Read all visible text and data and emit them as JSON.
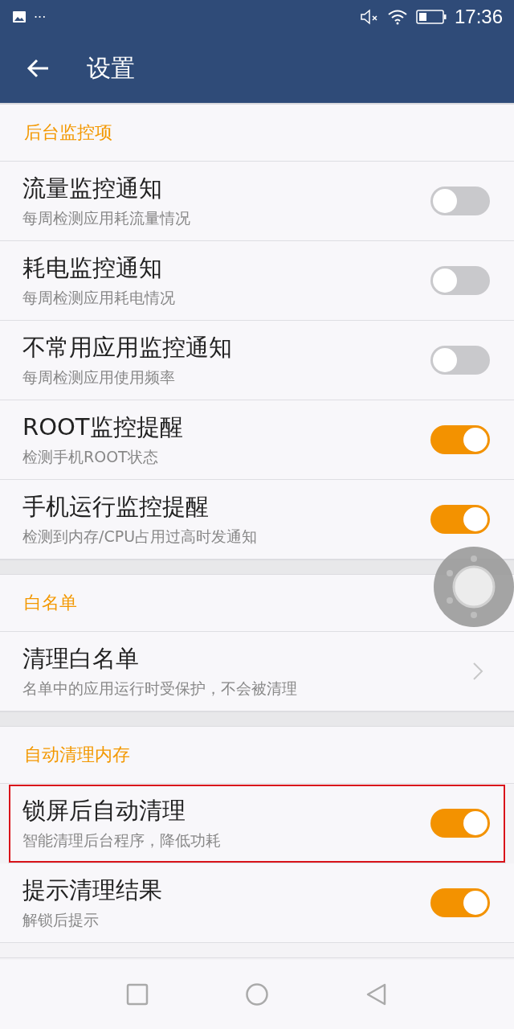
{
  "status_bar": {
    "notification_more": "···",
    "time": "17:36"
  },
  "toolbar": {
    "title": "设置"
  },
  "sections": [
    {
      "header": "后台监控项",
      "items": [
        {
          "kind": "toggle",
          "title": "流量监控通知",
          "subtitle": "每周检测应用耗流量情况",
          "on": false,
          "highlighted": false
        },
        {
          "kind": "toggle",
          "title": "耗电监控通知",
          "subtitle": "每周检测应用耗电情况",
          "on": false,
          "highlighted": false
        },
        {
          "kind": "toggle",
          "title": "不常用应用监控通知",
          "subtitle": "每周检测应用使用频率",
          "on": false,
          "highlighted": false
        },
        {
          "kind": "toggle",
          "title": "ROOT监控提醒",
          "subtitle": "检测手机ROOT状态",
          "on": true,
          "highlighted": false
        },
        {
          "kind": "toggle",
          "title": "手机运行监控提醒",
          "subtitle": "检测到内存/CPU占用过高时发通知",
          "on": true,
          "highlighted": false
        }
      ]
    },
    {
      "header": "白名单",
      "items": [
        {
          "kind": "link",
          "title": "清理白名单",
          "subtitle": "名单中的应用运行时受保护，不会被清理",
          "highlighted": false
        }
      ]
    },
    {
      "header": "自动清理内存",
      "items": [
        {
          "kind": "toggle",
          "title": "锁屏后自动清理",
          "subtitle": "智能清理后台程序，降低功耗",
          "on": true,
          "highlighted": true
        },
        {
          "kind": "toggle",
          "title": "提示清理结果",
          "subtitle": "解锁后提示",
          "on": true,
          "highlighted": false
        }
      ]
    }
  ]
}
